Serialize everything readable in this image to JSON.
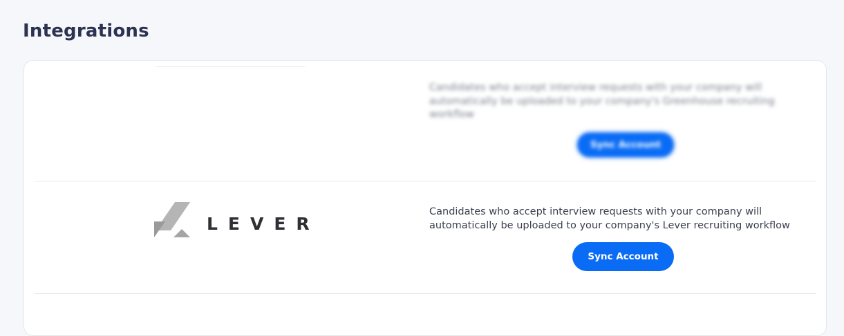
{
  "page": {
    "title": "Integrations"
  },
  "integrations": [
    {
      "name": "Greenhouse",
      "description": "Candidates who accept interview requests with your company will automatically be uploaded to your company's Greenhouse recruiting workflow",
      "button_label": "Sync Account",
      "blurred": true
    },
    {
      "name": "Lever",
      "logo_text": "LEVER",
      "description": "Candidates who accept interview requests with your company will automatically be uploaded to your company's Lever recruiting workflow",
      "button_label": "Sync Account",
      "blurred": false
    }
  ],
  "colors": {
    "primary": "#0a6cf5",
    "title": "#2c3350",
    "background": "#f6f7fb",
    "logo_gray": "#9e9e9e"
  }
}
